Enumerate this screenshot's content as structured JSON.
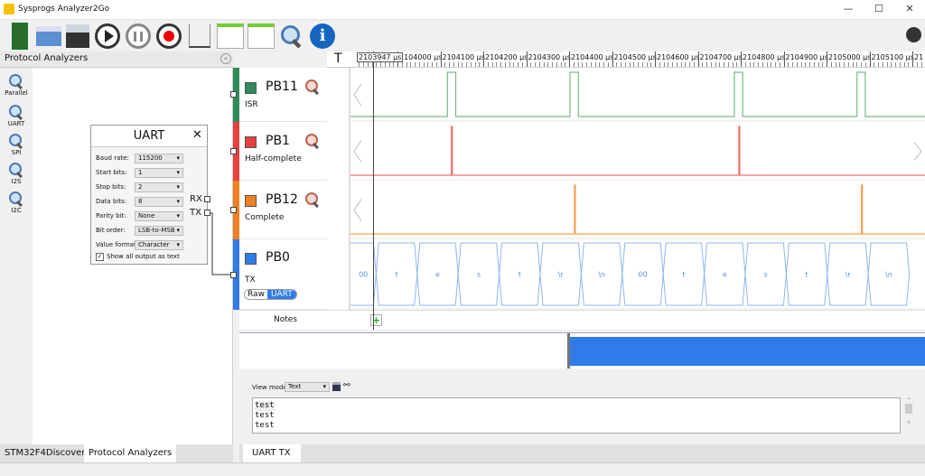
{
  "window": {
    "title": "Sysprogs Analyzer2Go",
    "min": "—",
    "max": "☐",
    "close": "✕"
  },
  "toolbar": {
    "items": [
      "board-icon",
      "open-icon",
      "save-icon",
      "play-icon",
      "pause-icon",
      "record-icon",
      "trigger-icon",
      "open-layout-icon",
      "save-layout-icon",
      "zoom-out-icon",
      "info-icon"
    ]
  },
  "left_panel": {
    "title": "Protocol Analyzers",
    "collapse": "«",
    "analyzers": [
      {
        "label": "Parallel"
      },
      {
        "label": "UART"
      },
      {
        "label": "SPI"
      },
      {
        "label": "I2S"
      },
      {
        "label": "I2C"
      }
    ],
    "uart_box": {
      "title": "UART",
      "close": "✕",
      "fields": [
        {
          "label": "Baud rate:",
          "value": "115200"
        },
        {
          "label": "Start bits:",
          "value": "1"
        },
        {
          "label": "Stop bits:",
          "value": "2"
        },
        {
          "label": "Data bits:",
          "value": "8"
        },
        {
          "label": "Parity bit:",
          "value": "None"
        },
        {
          "label": "Bit order:",
          "value": "LSB-to-MSB"
        },
        {
          "label": "Value format:",
          "value": "Character"
        }
      ],
      "checkbox": {
        "label": "Show all output as text",
        "checked": true
      },
      "ports": {
        "rx": "RX",
        "tx": "TX"
      }
    },
    "tabs": [
      "STM32F4Discovery",
      "Protocol Analyzers"
    ],
    "active_tab": 1
  },
  "ruler": {
    "t_label": "T",
    "cursor": "2103947 µs",
    "ticks": [
      "2104000 µs",
      "2104100 µs",
      "2104200 µs",
      "2104300 µs",
      "2104400 µs",
      "2104500 µs",
      "2104600 µs",
      "2104700 µs",
      "2104800 µs",
      "2104900 µs",
      "2105000 µs",
      "2105100 µs",
      "21"
    ]
  },
  "channels": [
    {
      "name": "PB11",
      "desc": "ISR",
      "color": "#2e8b57",
      "wave": "#79b98e",
      "pulses_us": [
        [
          2104100,
          2104117
        ],
        [
          2104350,
          2104367
        ],
        [
          2104685,
          2104702
        ],
        [
          2104935,
          2104952
        ]
      ]
    },
    {
      "name": "PB1",
      "desc": "Half-complete",
      "color": "#e84040",
      "wave": "#f07070",
      "pulses_us": [
        [
          2104108,
          2104110
        ],
        [
          2104694,
          2104696
        ]
      ]
    },
    {
      "name": "PB12",
      "desc": "Complete",
      "color": "#f08020",
      "wave": "#f5a050",
      "pulses_us": [
        [
          2104359,
          2104361
        ],
        [
          2104944,
          2104946
        ]
      ]
    },
    {
      "name": "PB0",
      "desc": "TX",
      "color": "#2f7be8",
      "wave": "#8fb5ee",
      "mode": {
        "raw": "Raw",
        "uart": "UART",
        "active": "UART"
      },
      "frames": [
        "00",
        "t",
        "e",
        "s",
        "t",
        "\\r",
        "\\n",
        "00",
        "t",
        "e",
        "s",
        "t",
        "\\r",
        "\\n"
      ]
    }
  ],
  "notes": {
    "label": "Notes",
    "add": "+"
  },
  "bottom": {
    "view_mode_label": "View mode:",
    "view_mode": "Text",
    "output_lines": [
      "test",
      "test",
      "test"
    ],
    "tab": "UART TX"
  }
}
